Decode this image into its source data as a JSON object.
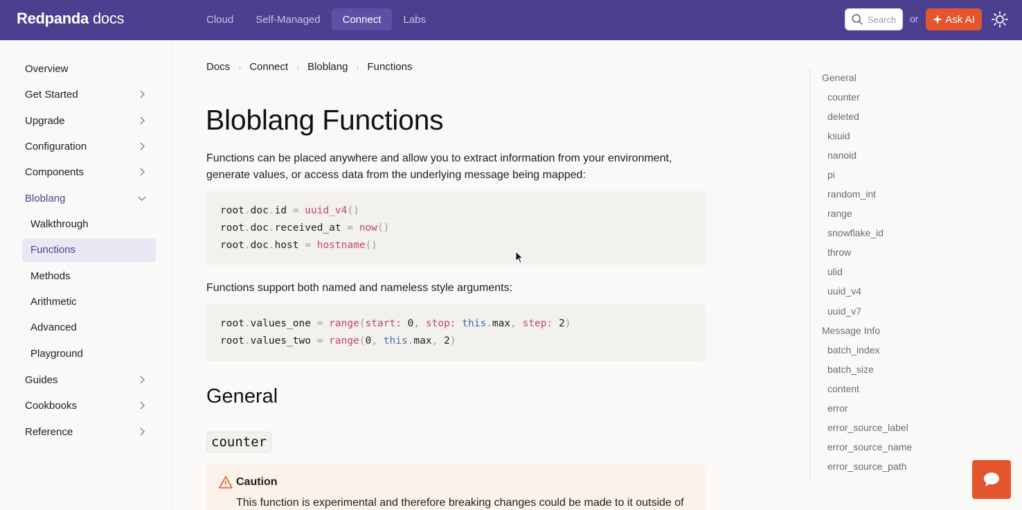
{
  "nav": {
    "brand_main": "Redpanda",
    "brand_sub": "docs",
    "links": [
      "Cloud",
      "Self-Managed",
      "Connect",
      "Labs"
    ],
    "active_link": "Connect",
    "search_placeholder": "Search",
    "or_text": "or",
    "ask_ai_label": "Ask AI"
  },
  "sidebar": {
    "items": [
      {
        "label": "Overview"
      },
      {
        "label": "Get Started"
      },
      {
        "label": "Upgrade"
      },
      {
        "label": "Configuration"
      },
      {
        "label": "Components"
      },
      {
        "label": "Bloblang"
      },
      {
        "label": "Guides"
      },
      {
        "label": "Cookbooks"
      },
      {
        "label": "Reference"
      }
    ],
    "bloblang_children": [
      "Walkthrough",
      "Functions",
      "Methods",
      "Arithmetic",
      "Advanced",
      "Playground"
    ],
    "active_child": "Functions"
  },
  "breadcrumb": [
    "Docs",
    "Connect",
    "Bloblang",
    "Functions"
  ],
  "main": {
    "title": "Bloblang Functions",
    "intro_line1": "Functions can be placed anywhere and allow you to extract information from your environment,",
    "intro_line2": "generate values, or access data from the underlying message being mapped:",
    "args_text": "Functions support both named and nameless style arguments:",
    "section_title": "General",
    "counter_tag": "counter",
    "caution_title": "Caution",
    "caution_body": "This function is experimental and therefore breaking changes could be made to it outside of"
  },
  "toc": {
    "general_head": "General",
    "general_items": [
      "counter",
      "deleted",
      "ksuid",
      "nanoid",
      "pi",
      "random_int",
      "range",
      "snowflake_id",
      "throw",
      "ulid",
      "uuid_v4",
      "uuid_v7"
    ],
    "message_head": "Message Info",
    "message_items": [
      "batch_index",
      "batch_size",
      "content",
      "error",
      "error_source_label",
      "error_source_name",
      "error_source_path"
    ]
  },
  "colors": {
    "nav_bg": "#4b3f8f",
    "accent": "#e2552d",
    "active_bg": "#e9e7f4"
  }
}
